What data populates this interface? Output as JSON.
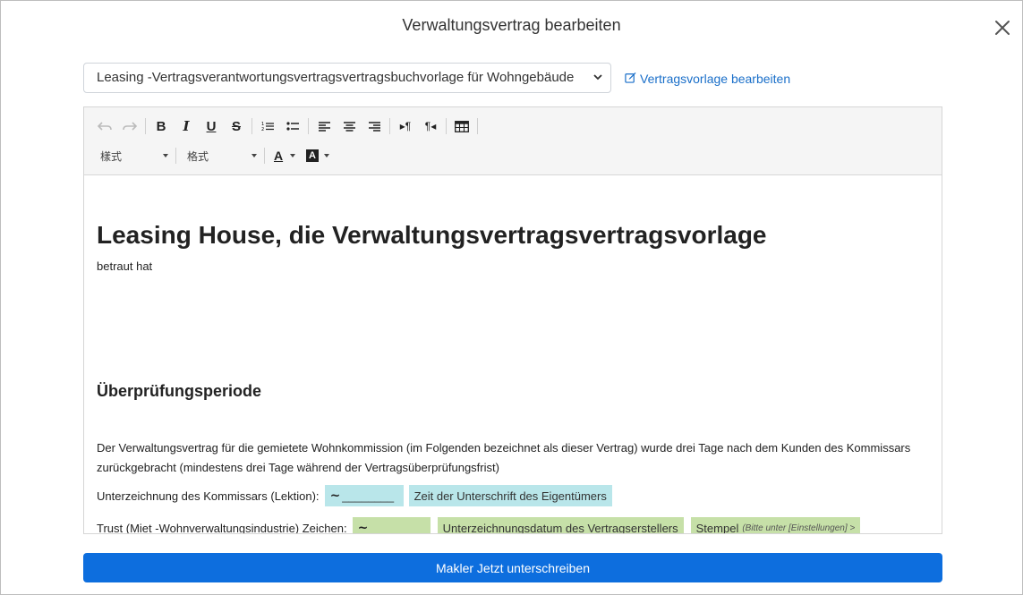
{
  "modal": {
    "title": "Verwaltungsvertrag bearbeiten",
    "close_icon": "close-icon"
  },
  "template_select": {
    "value": "Leasing -Vertragsverantwortungsvertragsvertragsbuchvorlage für Wohngebäude"
  },
  "edit_template_link": "Vertragsvorlage bearbeiten",
  "toolbar": {
    "style_dropdown": "樣式",
    "format_dropdown": "格式",
    "icons": [
      "undo-icon",
      "redo-icon",
      "bold-icon",
      "italic-icon",
      "underline-icon",
      "strikethrough-icon",
      "ordered-list-icon",
      "unordered-list-icon",
      "align-left-icon",
      "align-center-icon",
      "align-right-icon",
      "ltr-icon",
      "rtl-icon",
      "table-icon",
      "font-color-icon",
      "background-color-icon"
    ]
  },
  "document": {
    "title": "Leasing House, die Verwaltungsvertragsvertragsvorlage",
    "subtitle": "betraut hat",
    "section_heading": "Überprüfungsperiode",
    "paragraph": "Der Verwaltungsvertrag für die gemietete Wohnkommission (im Folgenden bezeichnet als dieser Vertrag) wurde drei Tage nach dem Kunden des Kommissars zurückgebracht (mindestens drei Tage während der Vertragsüberprüfungsfrist)",
    "line1": {
      "label": "Unterzeichnung des Kommissars (Lektion):",
      "sig_placeholder": "________",
      "time_field": "Zeit der Unterschrift des Eigentümers"
    },
    "line2": {
      "label": "Trust (Miet -Wohnverwaltungsindustrie) Zeichen:",
      "date_field": "Unterzeichnungsdatum des Vertragserstellers",
      "stamp_field": "Stempel",
      "stamp_hint": "(Bitte unter [Einstellungen] >"
    }
  },
  "primary_button": "Makler Jetzt unterschreiben",
  "colors": {
    "primary": "#0d6ede",
    "link": "#1a6fc9",
    "field_cyan": "#b9e6ea",
    "field_green": "#c6e0a8"
  }
}
